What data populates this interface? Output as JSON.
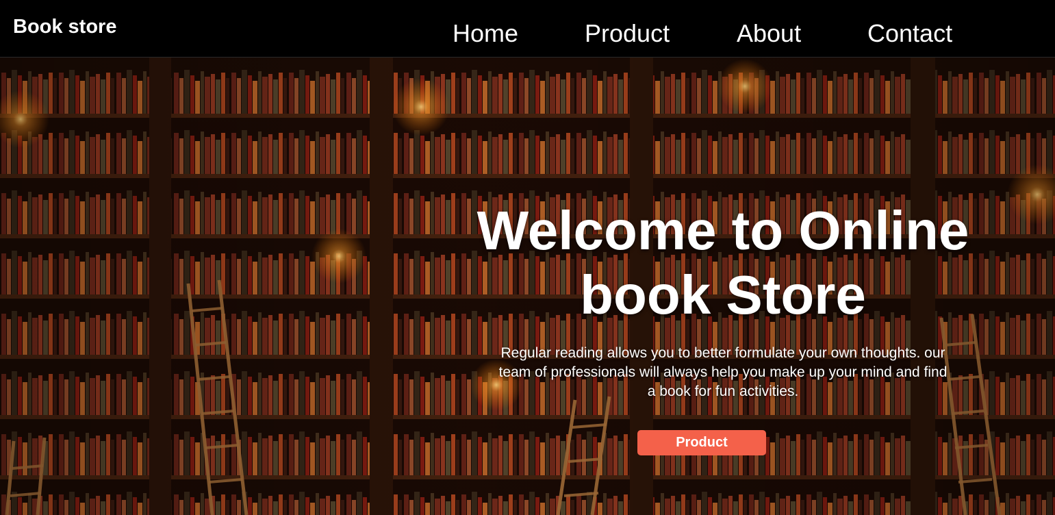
{
  "header": {
    "brand": "Book store",
    "nav": [
      {
        "label": "Home"
      },
      {
        "label": "Product"
      },
      {
        "label": "About"
      },
      {
        "label": "Contact"
      }
    ]
  },
  "hero": {
    "title_line1": "Welcome to Online",
    "title_line2": "book Store",
    "text_line1": "Regular reading allows you to better formulate your own thoughts. our",
    "text_line2": "team of professionals will always help you make up your mind and find",
    "text_line3": "a book for fun activities.",
    "button_label": "Product",
    "background_image": "library-bookshelves-with-ladders-and-candles"
  },
  "colors": {
    "navbar_bg": "#000000",
    "nav_text": "#ffffff",
    "button_bg": "#f4614a",
    "hero_text": "#ffffff"
  }
}
